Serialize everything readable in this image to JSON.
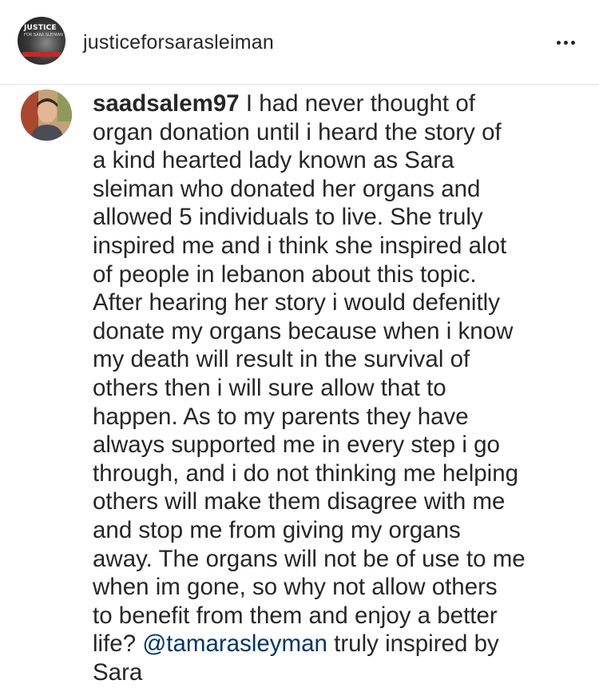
{
  "post": {
    "account_name": "justiceforsarasleiman",
    "avatar_logo": {
      "title": "JUSTICE",
      "subtitle": "FOR SARA SLEIMAN"
    }
  },
  "comment": {
    "username": "saadsalem97",
    "lines": [
      "I had never thought of",
      "organ donation until i heard the story of",
      "a kind hearted lady known as Sara",
      "sleiman who donated her organs and",
      "allowed 5 individuals to live. She truly",
      "inspired me and i think she inspired alot",
      "of people in lebanon about this topic.",
      "After hearing her story i would defenitly",
      "donate my organs because when i know",
      "my death will result in the survival of",
      "others then i will sure allow that to",
      "happen. As to my parents they have",
      "always supported me in every step i go",
      "through, and i do not thinking me helping",
      "others will make them disagree with me",
      "and stop me from giving my organs",
      "away. The organs will not be of use to me",
      "when im gone, so why not allow others",
      "to benefit from them and enjoy a better"
    ],
    "line_20_start": "life?",
    "mention": "@tamarasleyman",
    "line_20_end": "truly inspired by",
    "last_line": "Sara"
  },
  "colors": {
    "text": "#262626",
    "mention": "#003569",
    "divider": "#e6e6e6"
  },
  "icons": {
    "more": "more-horizontal-icon"
  }
}
